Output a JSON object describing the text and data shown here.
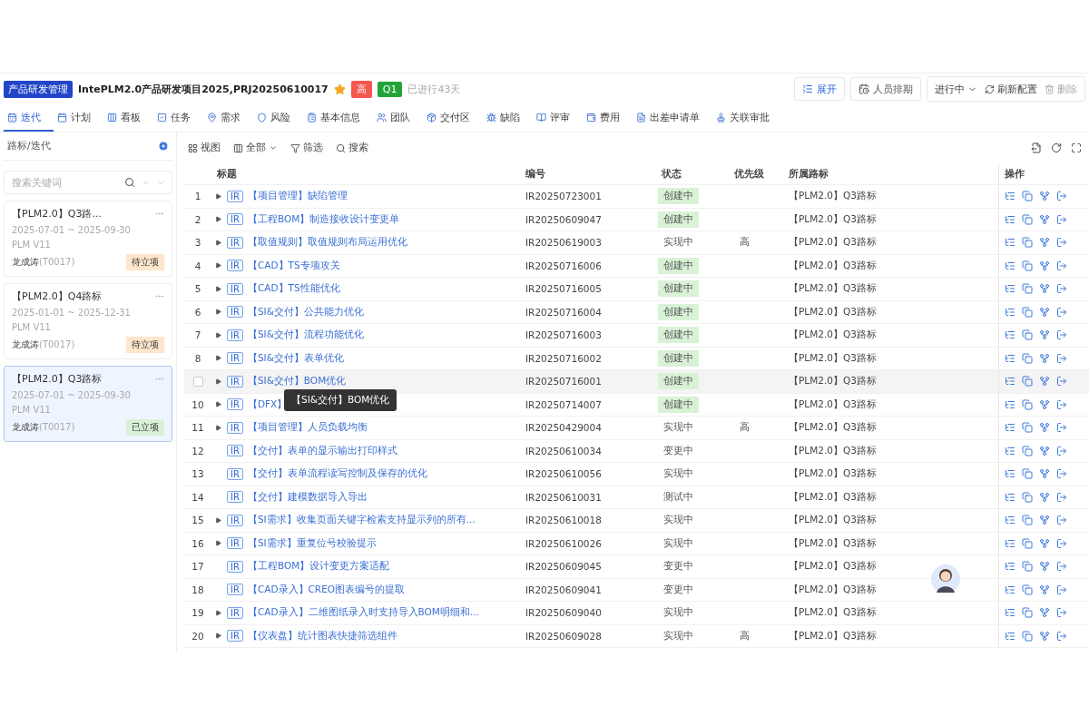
{
  "header": {
    "module": "产品研发管理",
    "title": "IntePLM2.0产品研发项目2025,PRJ20250610017",
    "starred": true,
    "tags": [
      {
        "label": "高",
        "color": "#f5574f"
      },
      {
        "label": "Q1",
        "color": "#22a33a"
      }
    ],
    "elapsed": "已进行43天",
    "actions": [
      {
        "kind": "primary",
        "label": "展开"
      },
      {
        "kind": "plain",
        "label": "人员排期"
      }
    ],
    "status": "进行中",
    "refresh": "刷新配置",
    "delete": "删除"
  },
  "tabs": [
    {
      "label": "迭代",
      "selected": true
    },
    {
      "label": "计划",
      "selected": false
    },
    {
      "label": "看板",
      "selected": false
    },
    {
      "label": "任务",
      "selected": false
    },
    {
      "label": "需求",
      "selected": false
    },
    {
      "label": "风险",
      "selected": false
    },
    {
      "label": "基本信息",
      "selected": false
    },
    {
      "label": "团队",
      "selected": false
    },
    {
      "label": "交付区",
      "selected": false
    },
    {
      "label": "缺陷",
      "selected": false
    },
    {
      "label": "评审",
      "selected": false
    },
    {
      "label": "费用",
      "selected": false
    },
    {
      "label": "出差申请单",
      "selected": false
    },
    {
      "label": "关联审批",
      "selected": false
    }
  ],
  "sidebar": {
    "title": "路标/迭代",
    "search": {
      "placeholder": "搜索关键词"
    },
    "items": [
      {
        "title": "【PLM2.0】Q3路...",
        "dates": "2025-07-01 ~ 2025-09-30",
        "version": "PLM V11",
        "owner": "龙成涛",
        "owner_id": "(T0017)",
        "status": "待立项",
        "color": "#fde6cc",
        "selected": false
      },
      {
        "title": "【PLM2.0】Q4路标",
        "dates": "2025-01-01 ~ 2025-12-31",
        "version": "PLM V11",
        "owner": "龙成涛",
        "owner_id": "(T0017)",
        "status": "待立项",
        "color": "#fde6cc",
        "selected": false
      },
      {
        "title": "【PLM2.0】Q3路标",
        "dates": "2025-07-01 ~ 2025-09-30",
        "version": "PLM V11",
        "owner": "龙成涛",
        "owner_id": "(T0017)",
        "status": "已立项",
        "color": "#d8f0d6",
        "selected": true
      }
    ]
  },
  "toolbar": {
    "view": "视图",
    "scope": "全部",
    "filter": "筛选",
    "search": "搜索"
  },
  "table": {
    "columns": [
      "标题",
      "编号",
      "状态",
      "优先级",
      "所属路标",
      "操作"
    ],
    "tooltip": "【SI&交付】BOM优化",
    "rows": [
      {
        "index": "1",
        "expandable": true,
        "hovered": false,
        "type": "IR",
        "title": "【项目管理】缺陷管理",
        "code": "IR20250723001",
        "status": "创建中",
        "color": "#d9f2d6",
        "priority": "",
        "milestone": "【PLM2.0】Q3路标"
      },
      {
        "index": "2",
        "expandable": true,
        "hovered": false,
        "type": "IR",
        "title": "【工程BOM】制造接收设计变更单",
        "code": "IR20250609047",
        "status": "创建中",
        "color": "#d9f2d6",
        "priority": "",
        "milestone": "【PLM2.0】Q3路标"
      },
      {
        "index": "3",
        "expandable": true,
        "hovered": false,
        "type": "IR",
        "title": "【取值规则】取值规则布局运用优化",
        "code": "IR20250619003",
        "status": "实现中",
        "priority": "高",
        "milestone": "【PLM2.0】Q3路标"
      },
      {
        "index": "4",
        "expandable": true,
        "hovered": false,
        "type": "IR",
        "title": "【CAD】TS专项攻关",
        "code": "IR20250716006",
        "status": "创建中",
        "color": "#d9f2d6",
        "priority": "",
        "milestone": "【PLM2.0】Q3路标"
      },
      {
        "index": "5",
        "expandable": true,
        "hovered": false,
        "type": "IR",
        "title": "【CAD】TS性能优化",
        "code": "IR20250716005",
        "status": "创建中",
        "color": "#d9f2d6",
        "priority": "",
        "milestone": "【PLM2.0】Q3路标"
      },
      {
        "index": "6",
        "expandable": true,
        "hovered": false,
        "type": "IR",
        "title": "【SI&交付】公共能力优化",
        "code": "IR20250716004",
        "status": "创建中",
        "color": "#d9f2d6",
        "priority": "",
        "milestone": "【PLM2.0】Q3路标"
      },
      {
        "index": "7",
        "expandable": true,
        "hovered": false,
        "type": "IR",
        "title": "【SI&交付】流程功能优化",
        "code": "IR20250716003",
        "status": "创建中",
        "color": "#d9f2d6",
        "priority": "",
        "milestone": "【PLM2.0】Q3路标"
      },
      {
        "index": "8",
        "expandable": true,
        "hovered": false,
        "type": "IR",
        "title": "【SI&交付】表单优化",
        "code": "IR20250716002",
        "status": "创建中",
        "color": "#d9f2d6",
        "priority": "",
        "milestone": "【PLM2.0】Q3路标"
      },
      {
        "expandable": true,
        "hovered": true,
        "type": "IR",
        "title": "【SI&交付】BOM优化",
        "code": "IR20250716001",
        "status": "创建中",
        "color": "#d9f2d6",
        "priority": "",
        "milestone": "【PLM2.0】Q3路标"
      },
      {
        "index": "10",
        "expandable": true,
        "hovered": false,
        "type": "IR",
        "title": "【DFX】",
        "code": "IR20250714007",
        "status": "创建中",
        "color": "#d9f2d6",
        "priority": "",
        "milestone": "【PLM2.0】Q3路标"
      },
      {
        "index": "11",
        "expandable": true,
        "hovered": false,
        "type": "IR",
        "title": "【项目管理】人员负载均衡",
        "code": "IR20250429004",
        "status": "实现中",
        "priority": "高",
        "milestone": "【PLM2.0】Q3路标"
      },
      {
        "index": "12",
        "expandable": false,
        "hovered": false,
        "type": "IR",
        "title": "【交付】表单的显示输出打印样式",
        "code": "IR20250610034",
        "status": "变更中",
        "priority": "",
        "milestone": "【PLM2.0】Q3路标"
      },
      {
        "index": "13",
        "expandable": false,
        "hovered": false,
        "type": "IR",
        "title": "【交付】表单流程读写控制及保存的优化",
        "code": "IR20250610056",
        "status": "实现中",
        "priority": "",
        "milestone": "【PLM2.0】Q3路标"
      },
      {
        "index": "14",
        "expandable": false,
        "hovered": false,
        "type": "IR",
        "title": "【交付】建模数据导入导出",
        "code": "IR20250610031",
        "status": "测试中",
        "priority": "",
        "milestone": "【PLM2.0】Q3路标"
      },
      {
        "index": "15",
        "expandable": true,
        "hovered": false,
        "type": "IR",
        "title": "【SI需求】收集页面关键字检索支持显示列的所有...",
        "code": "IR20250610018",
        "status": "实现中",
        "priority": "",
        "milestone": "【PLM2.0】Q3路标"
      },
      {
        "index": "16",
        "expandable": true,
        "hovered": false,
        "type": "IR",
        "title": "【SI需求】重复位号校验提示",
        "code": "IR20250610026",
        "status": "实现中",
        "priority": "",
        "milestone": "【PLM2.0】Q3路标"
      },
      {
        "index": "17",
        "expandable": false,
        "hovered": false,
        "type": "IR",
        "title": "【工程BOM】设计变更方案适配",
        "code": "IR20250609045",
        "status": "变更中",
        "priority": "",
        "milestone": "【PLM2.0】Q3路标"
      },
      {
        "index": "18",
        "expandable": false,
        "hovered": false,
        "type": "IR",
        "title": "【CAD录入】CREO图表编号的提取",
        "code": "IR20250609041",
        "status": "变更中",
        "priority": "",
        "milestone": "【PLM2.0】Q3路标"
      },
      {
        "index": "19",
        "expandable": true,
        "hovered": false,
        "type": "IR",
        "title": "【CAD录入】二维图纸录入时支持导入BOM明细和...",
        "code": "IR20250609040",
        "status": "实现中",
        "priority": "",
        "milestone": "【PLM2.0】Q3路标"
      },
      {
        "index": "20",
        "expandable": true,
        "hovered": false,
        "type": "IR",
        "title": "【仪表盘】统计图表快捷筛选组件",
        "code": "IR20250609028",
        "status": "实现中",
        "priority": "高",
        "milestone": "【PLM2.0】Q3路标"
      }
    ]
  }
}
